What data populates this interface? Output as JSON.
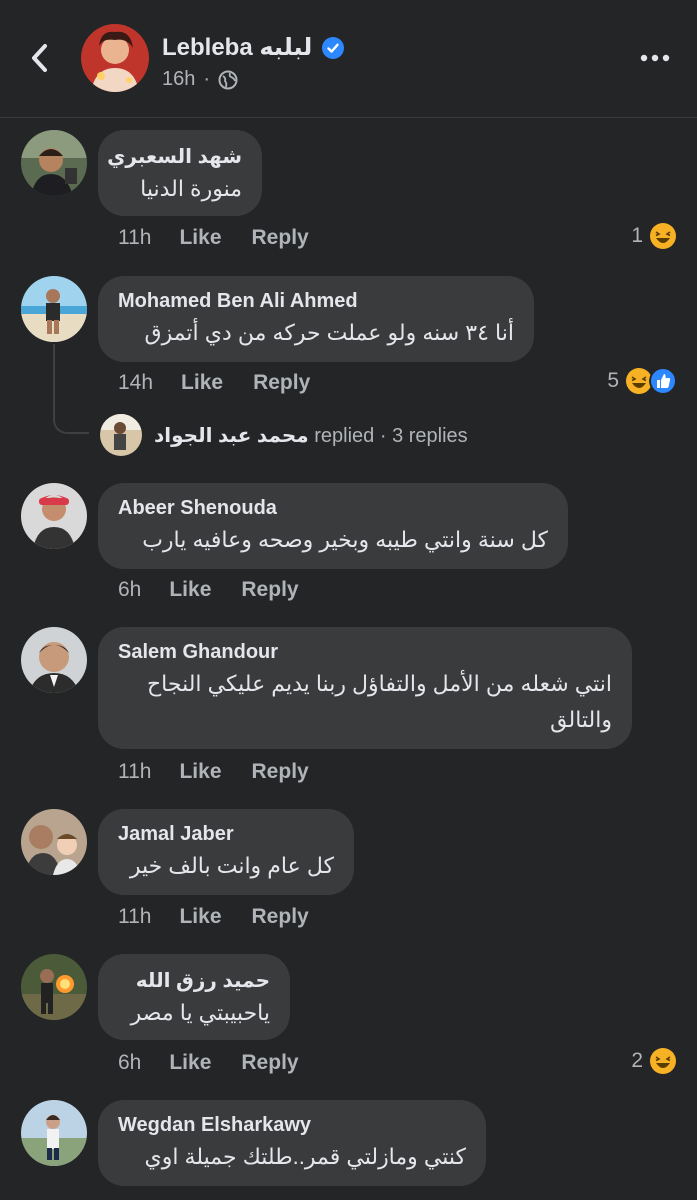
{
  "header": {
    "page_name": "Lebleba لبلبه",
    "time": "16h",
    "separator": "·",
    "icons": {
      "back": "chevron-left-icon",
      "verified": "verified-badge-icon",
      "audience": "globe-icon",
      "more": "more-dots-icon"
    }
  },
  "actions": {
    "like": "Like",
    "reply": "Reply"
  },
  "comments": [
    {
      "author": "شهد السعبري",
      "text": "منورة الدنيا",
      "time": "11h",
      "reaction_count": "1",
      "reactions": [
        "haha"
      ]
    },
    {
      "author": "Mohamed Ben Ali Ahmed",
      "text": "أنا ٣٤ سنه ولو عملت حركه من دي أتمزق",
      "time": "14h",
      "reaction_count": "5",
      "reactions": [
        "haha",
        "like"
      ],
      "replies": {
        "name": "محمد عبد الجواد",
        "verb": "replied",
        "count": "· 3 replies"
      }
    },
    {
      "author": "Abeer Shenouda",
      "text": "كل سنة وانتي طيبه وبخير وصحه وعافيه يارب",
      "time": "6h"
    },
    {
      "author": "Salem Ghandour",
      "text": "انتي شعله من الأمل والتفاؤل ربنا يديم عليكي النجاح والتالق",
      "time": "11h"
    },
    {
      "author": "Jamal Jaber",
      "text": "كل عام وانت بالف خير",
      "time": "11h"
    },
    {
      "author": "حميد رزق الله",
      "text": "ياحبيبتي يا مصر",
      "time": "6h",
      "reaction_count": "2",
      "reactions": [
        "haha"
      ]
    },
    {
      "author": "Wegdan Elsharkawy",
      "text": "كنتي ومازلتي قمر..طلتك جميلة اوي",
      "time": "6h"
    }
  ],
  "colors": {
    "background": "#242526",
    "bubble": "#3a3b3c",
    "secondary_text": "#b0b3b8",
    "accent": "#2d88ff",
    "haha": "#f7b125"
  }
}
